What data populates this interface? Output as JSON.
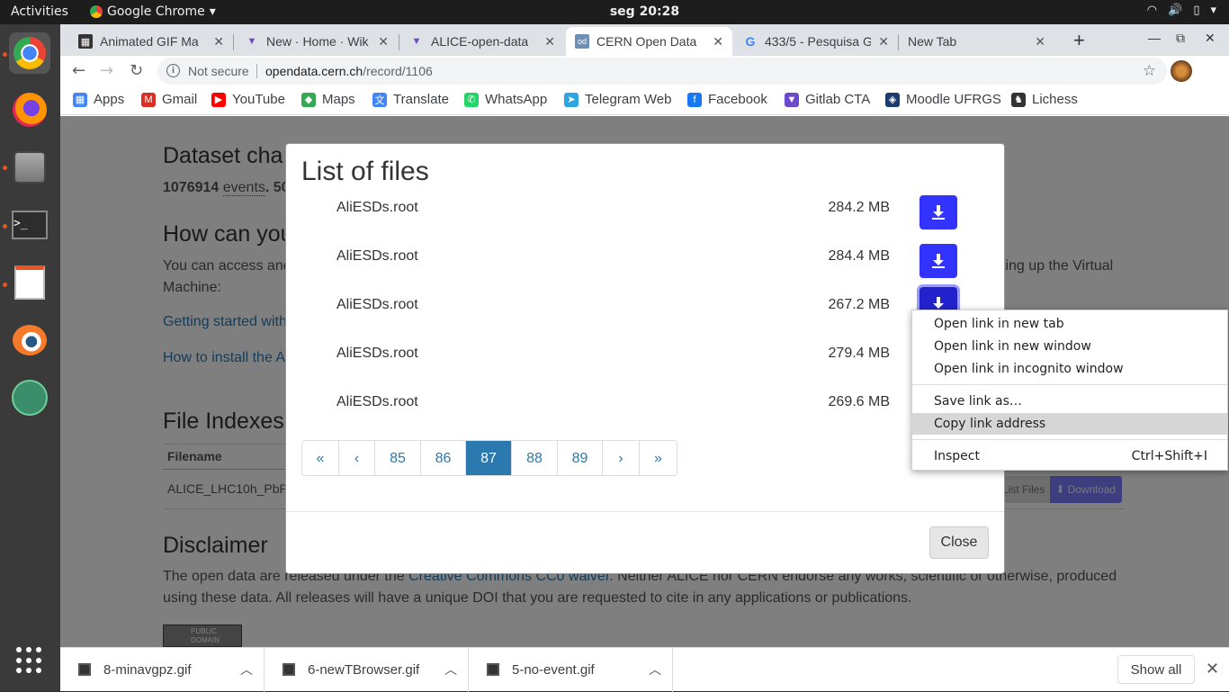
{
  "topbar": {
    "activities": "Activities",
    "app_name": "Google Chrome",
    "clock": "seg 20:28"
  },
  "tabs": [
    {
      "title": "Animated GIF Ma",
      "favicon": "gif-icon",
      "active": false
    },
    {
      "title": "New · Home · Wik",
      "favicon": "gitlab-icon",
      "active": false
    },
    {
      "title": "ALICE-open-data",
      "favicon": "gitlab-icon",
      "active": false
    },
    {
      "title": "CERN Open Data",
      "favicon": "od-icon",
      "active": true
    },
    {
      "title": "433/5 - Pesquisa G",
      "favicon": "google-icon",
      "active": false
    },
    {
      "title": "New Tab",
      "favicon": "",
      "active": false
    }
  ],
  "toolbar": {
    "security_text": "Not secure",
    "url_host": "opendata.cern.ch",
    "url_path": "/record/1106"
  },
  "bookmarks": [
    {
      "label": "Apps",
      "icon": "apps-grid-icon",
      "color": "#4285f4"
    },
    {
      "label": "Gmail",
      "icon": "gmail-icon",
      "color": "#d93025"
    },
    {
      "label": "YouTube",
      "icon": "youtube-icon",
      "color": "#ff0000"
    },
    {
      "label": "Maps",
      "icon": "maps-icon",
      "color": "#34a853"
    },
    {
      "label": "Translate",
      "icon": "translate-icon",
      "color": "#4285f4"
    },
    {
      "label": "WhatsApp",
      "icon": "whatsapp-icon",
      "color": "#25d366"
    },
    {
      "label": "Telegram Web",
      "icon": "telegram-icon",
      "color": "#2ca5e0"
    },
    {
      "label": "Facebook",
      "icon": "facebook-icon",
      "color": "#1877f2"
    },
    {
      "label": "Gitlab CTA",
      "icon": "gitlab-icon",
      "color": "#6e49cb"
    },
    {
      "label": "Moodle UFRGS",
      "icon": "moodle-icon",
      "color": "#1a3c6e"
    },
    {
      "label": "Lichess",
      "icon": "lichess-icon",
      "color": "#333333"
    }
  ],
  "page": {
    "heading_dataset": "Dataset cha",
    "events_count": "1076914",
    "events_word": "events",
    "events_more": ". 50",
    "heading_how": "How can you",
    "access_text_start": "You can access and",
    "access_text_end": "ting up the Virtual",
    "access_text_line2": "Machine:",
    "link_getting_started": "Getting started with",
    "link_install": "How to install the A",
    "heading_file_indexes": "File Indexes",
    "col_filename": "Filename",
    "index_filename": "ALICE_LHC10h_PbP",
    "list_files_btn": "List Files",
    "download_btn": "Download",
    "heading_disclaimer": "Disclaimer",
    "disclaimer_pre": "The open data are released under the",
    "disclaimer_link": "Creative Commons CC0 waiver",
    "disclaimer_post": ". Neither ALICE nor CERN endorse any works, scientific or otherwise, produced",
    "disclaimer_line2": "using these data. All releases will have a unique DOI that you are requested to cite in any applications or publications.",
    "badge_line1": "PUBLIC",
    "badge_line2": "DOMAIN"
  },
  "modal": {
    "title": "List of files",
    "files": [
      {
        "name": "AliESDs.root",
        "size": "284.2 MB"
      },
      {
        "name": "AliESDs.root",
        "size": "284.4 MB"
      },
      {
        "name": "AliESDs.root",
        "size": "267.2 MB"
      },
      {
        "name": "AliESDs.root",
        "size": "279.4 MB"
      },
      {
        "name": "AliESDs.root",
        "size": "269.6 MB"
      }
    ],
    "pagination": [
      "«",
      "‹",
      "85",
      "86",
      "87",
      "88",
      "89",
      "›",
      "»"
    ],
    "current_page": "87",
    "close_label": "Close"
  },
  "context_menu": {
    "items": [
      {
        "label": "Open link in new tab",
        "shortcut": ""
      },
      {
        "label": "Open link in new window",
        "shortcut": ""
      },
      {
        "label": "Open link in incognito window",
        "shortcut": ""
      },
      {
        "label": "Save link as…",
        "shortcut": ""
      },
      {
        "label": "Copy link address",
        "shortcut": "",
        "highlighted": true
      },
      {
        "label": "Inspect",
        "shortcut": "Ctrl+Shift+I"
      }
    ]
  },
  "downloads": {
    "items": [
      {
        "name": "8-minavgpz.gif"
      },
      {
        "name": "6-newTBrowser.gif"
      },
      {
        "name": "5-no-event.gif"
      }
    ],
    "show_all": "Show all"
  },
  "colors": {
    "accent_blue": "#2a7ab0",
    "download_button": "#3333ff",
    "ubuntu_orange": "#e95420"
  }
}
